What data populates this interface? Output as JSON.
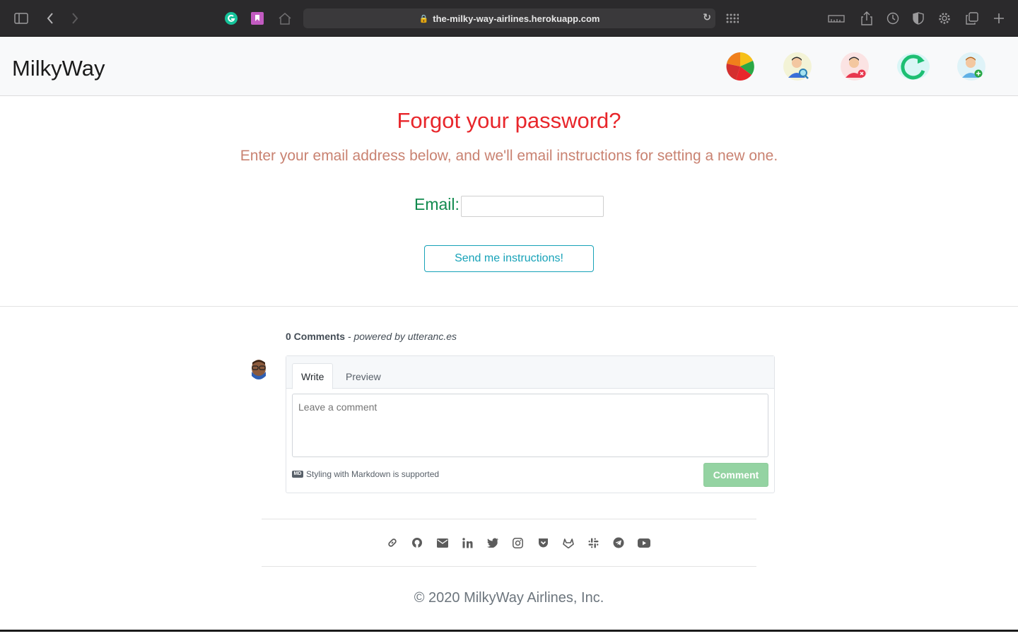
{
  "browser": {
    "url": "the-milky-way-airlines.herokuapp.com"
  },
  "navbar": {
    "brand": "MilkyWay",
    "icons": [
      "pie-chart-icon",
      "user-search-icon",
      "user-remove-icon",
      "refresh-icon",
      "user-add-icon"
    ]
  },
  "main": {
    "title": "Forgot your password?",
    "subtitle": "Enter your email address below, and we'll email instructions for setting a new one.",
    "email_label": "Email:",
    "email_value": "",
    "send_button": "Send me instructions!"
  },
  "comments": {
    "count_label": "0 Comments",
    "powered_by": "- powered by utteranc.es",
    "tabs": [
      "Write",
      "Preview"
    ],
    "placeholder": "Leave a comment",
    "markdown_note": "Styling with Markdown is supported",
    "markdown_icon": "MD",
    "submit_label": "Comment"
  },
  "footer": {
    "social": [
      "link-icon",
      "github-icon",
      "email-icon",
      "linkedin-icon",
      "twitter-icon",
      "instagram-icon",
      "pocket-icon",
      "gitlab-icon",
      "slack-icon",
      "telegram-icon",
      "youtube-icon"
    ],
    "copyright": "© 2020 MilkyWay Airlines, Inc."
  }
}
